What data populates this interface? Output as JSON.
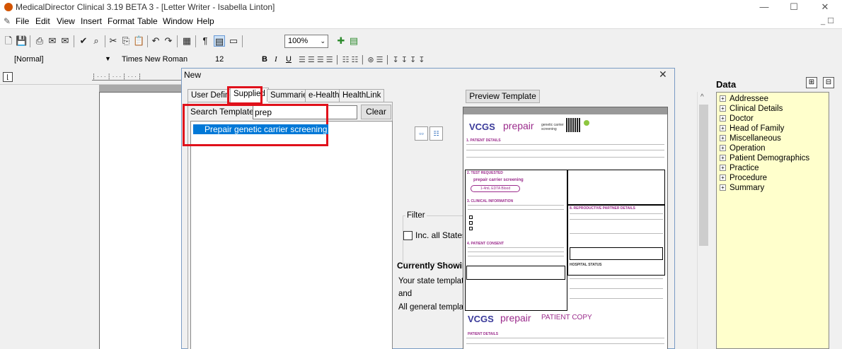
{
  "window": {
    "title": "MedicalDirector Clinical 3.19 BETA 3 - [Letter Writer - Isabella Linton]",
    "minimize": "—",
    "maximize": "☐",
    "close": "✕"
  },
  "menu": {
    "items": [
      "File",
      "Edit",
      "View",
      "Insert",
      "Format",
      "Table",
      "Window",
      "Help"
    ],
    "mdi_controls": "_ ☐"
  },
  "toolbar": {
    "zoom": "100%",
    "style": "[Normal]",
    "font": "Times New Roman",
    "font_size": "12",
    "bold": "B",
    "italic": "I",
    "underline": "U"
  },
  "data_panel": {
    "title": "Data",
    "items": [
      "Addressee",
      "Clinical Details",
      "Doctor",
      "Head of Family",
      "Miscellaneous",
      "Operation",
      "Patient Demographics",
      "Practice",
      "Procedure",
      "Summary"
    ]
  },
  "dialog": {
    "title": "New",
    "close": "✕",
    "tabs": [
      "User Defined",
      "Supplied",
      "Summaries",
      "e-Health",
      "HealthLink"
    ],
    "active_tab": "Supplied",
    "search_label": "Search Templates:",
    "search_value": "prep",
    "clear_label": "Clear",
    "result_item": "Prepair genetic carrier screening",
    "filter_label": "Filter",
    "inc_all_states": "Inc. all States",
    "currently_showing_title": "Currently Showing:",
    "showing_lines": [
      "Your state templates",
      "and",
      "All general templates"
    ],
    "preview_button": "Preview Template"
  },
  "preview": {
    "logo": "VCGS",
    "brand": "prepair",
    "brand_sub": "genetic carrier screening",
    "section_patient": "1. PATIENT DETAILS",
    "section_test": "2. TEST REQUESTED",
    "test_name": "prepair carrier screening",
    "sample": "1-4mL EDTA Blood",
    "section_clinical": "3. CLINICAL INFORMATION",
    "section_consent": "4. PATIENT CONSENT",
    "section_copy": "8. REPRODUCTIVE PARTNER DETAILS",
    "hospital_status": "HOSPITAL STATUS",
    "patient_copy": "PATIENT COPY",
    "patient_details": "PATIENT DETAILS"
  },
  "colors": {
    "highlight": "#0078d7",
    "annotation_red": "#e0111b",
    "tree_bg": "#ffffcc",
    "brand_purple": "#9b2c8c"
  }
}
